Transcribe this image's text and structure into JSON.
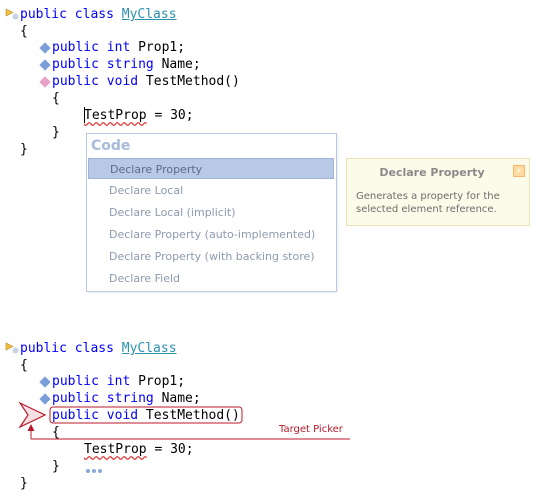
{
  "top_code": {
    "class_decl": {
      "keyword": "public class ",
      "name": "MyClass"
    },
    "open_brace": "{",
    "prop1": {
      "keywords": "public int",
      "rest": " Prop1;"
    },
    "name_prop": {
      "keywords": "public string",
      "rest": " Name;"
    },
    "method": {
      "keywords": "public void",
      "rest": " TestMethod()"
    },
    "method_open": "{",
    "statement": {
      "identifier": "TestProp",
      "rest": " = 30;"
    },
    "method_close": "}",
    "class_close": "}"
  },
  "code_popup": {
    "title": "Code",
    "items": [
      {
        "label": "Declare Property",
        "selected": true
      },
      {
        "label": "Declare Local"
      },
      {
        "label": "Declare Local (implicit)"
      },
      {
        "label": "Declare Property (auto-implemented)"
      },
      {
        "label": "Declare Property (with backing store)"
      },
      {
        "label": "Declare Field"
      }
    ]
  },
  "hint": {
    "title": "Declare Property",
    "close": "x",
    "description": "Generates a property for the selected element reference."
  },
  "bottom_code": {
    "class_decl": {
      "keyword": "public class ",
      "name": "MyClass"
    },
    "open_brace": "{",
    "prop1": {
      "keywords": "public int",
      "rest": " Prop1;"
    },
    "name_prop": {
      "keywords": "public string",
      "rest": " Name;"
    },
    "method": {
      "keywords": "public void",
      "rest": " TestMethod()"
    },
    "method_open": "{",
    "statement": {
      "identifier": "TestProp",
      "rest": " = 30;"
    },
    "method_close": "}",
    "class_close": "}"
  },
  "target_picker": {
    "label": "Target Picker"
  },
  "colors": {
    "keyword": "#0000ff",
    "type_name": "#2b91af",
    "popup_selected": "#b8c9e5",
    "hint_background": "#fcfae8",
    "target_picker": "#b8192a"
  }
}
